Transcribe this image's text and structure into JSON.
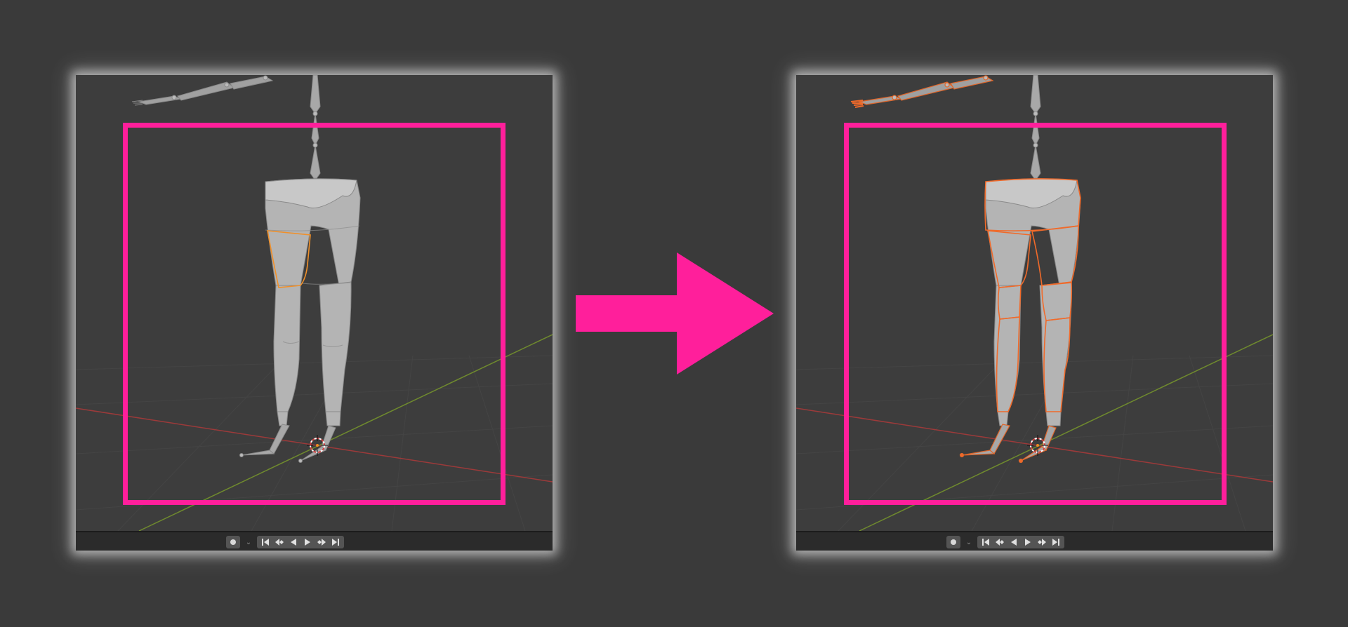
{
  "panels": [
    {
      "id": "before",
      "selected_outline_color": "#f0902a",
      "selection": "single-thigh"
    },
    {
      "id": "after",
      "selected_outline_color": "#f06a2a",
      "selection": "all-leg-parts"
    }
  ],
  "colors": {
    "background": "#3a3a3a",
    "viewport": "#3d3d3d",
    "highlight_frame": "#ff1f9b",
    "arrow": "#ff1f9b",
    "x_axis": "#9c3a3a",
    "y_axis": "#6f8a2e",
    "mesh": "#b4b4b4"
  },
  "timeline": {
    "record_icon": "record-icon",
    "record_dropdown_icon": "chevron-down-icon",
    "buttons": [
      "jump-to-start-icon",
      "jump-to-keyframe-back-icon",
      "play-reverse-icon",
      "play-icon",
      "jump-to-keyframe-forward-icon",
      "jump-to-end-icon"
    ]
  }
}
